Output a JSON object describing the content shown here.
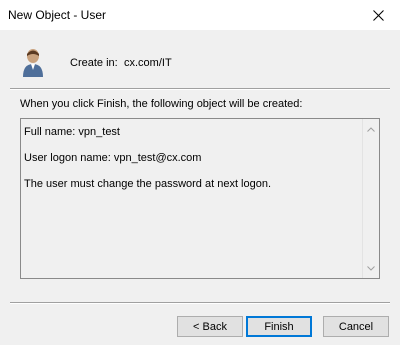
{
  "window": {
    "title": "New Object - User"
  },
  "header": {
    "create_in_label": "Create in:",
    "create_in_value": "cx.com/IT",
    "icon": "user-icon"
  },
  "intro_text": "When you click Finish, the following object will be created:",
  "summary": {
    "lines": [
      "Full name: vpn_test",
      "User logon name: vpn_test@cx.com",
      "The user must change the password at next logon."
    ]
  },
  "buttons": {
    "back": "< Back",
    "finish": "Finish",
    "cancel": "Cancel"
  }
}
